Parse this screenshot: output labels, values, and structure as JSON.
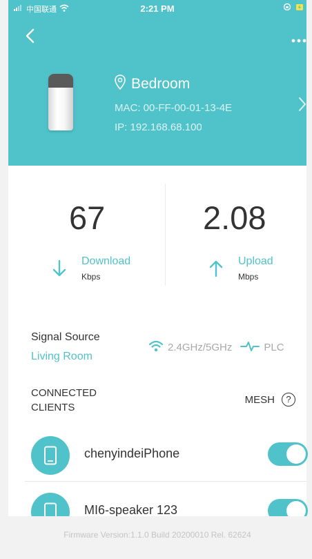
{
  "colors": {
    "accent": "#4fc3c9",
    "text": "#333333",
    "muted": "#a8a8a8"
  },
  "status_bar": {
    "carrier": "中国联通",
    "time": "2:21 PM"
  },
  "header": {
    "device_name": "Bedroom",
    "mac": "MAC: 00-FF-00-01-13-4E",
    "ip": "IP: 192.168.68.100"
  },
  "stats": {
    "download": {
      "value": "67",
      "label": "Download",
      "unit": "Kbps"
    },
    "upload": {
      "value": "2.08",
      "label": "Upload",
      "unit": "Mbps"
    }
  },
  "signal": {
    "title": "Signal Source",
    "source": "Living Room",
    "band": "2.4GHz/5GHz",
    "plc": "PLC"
  },
  "clients": {
    "title_line1": "CONNECTED",
    "title_line2": "CLIENTS",
    "mesh_label": "MESH",
    "help": "?",
    "items": [
      {
        "name": "chenyindeiPhone",
        "enabled": true
      },
      {
        "name": "MI6-speaker 123",
        "enabled": true
      }
    ]
  },
  "footer": {
    "firmware": "Firmware Version:1.1.0 Build 20200010 Rel. 62624"
  }
}
